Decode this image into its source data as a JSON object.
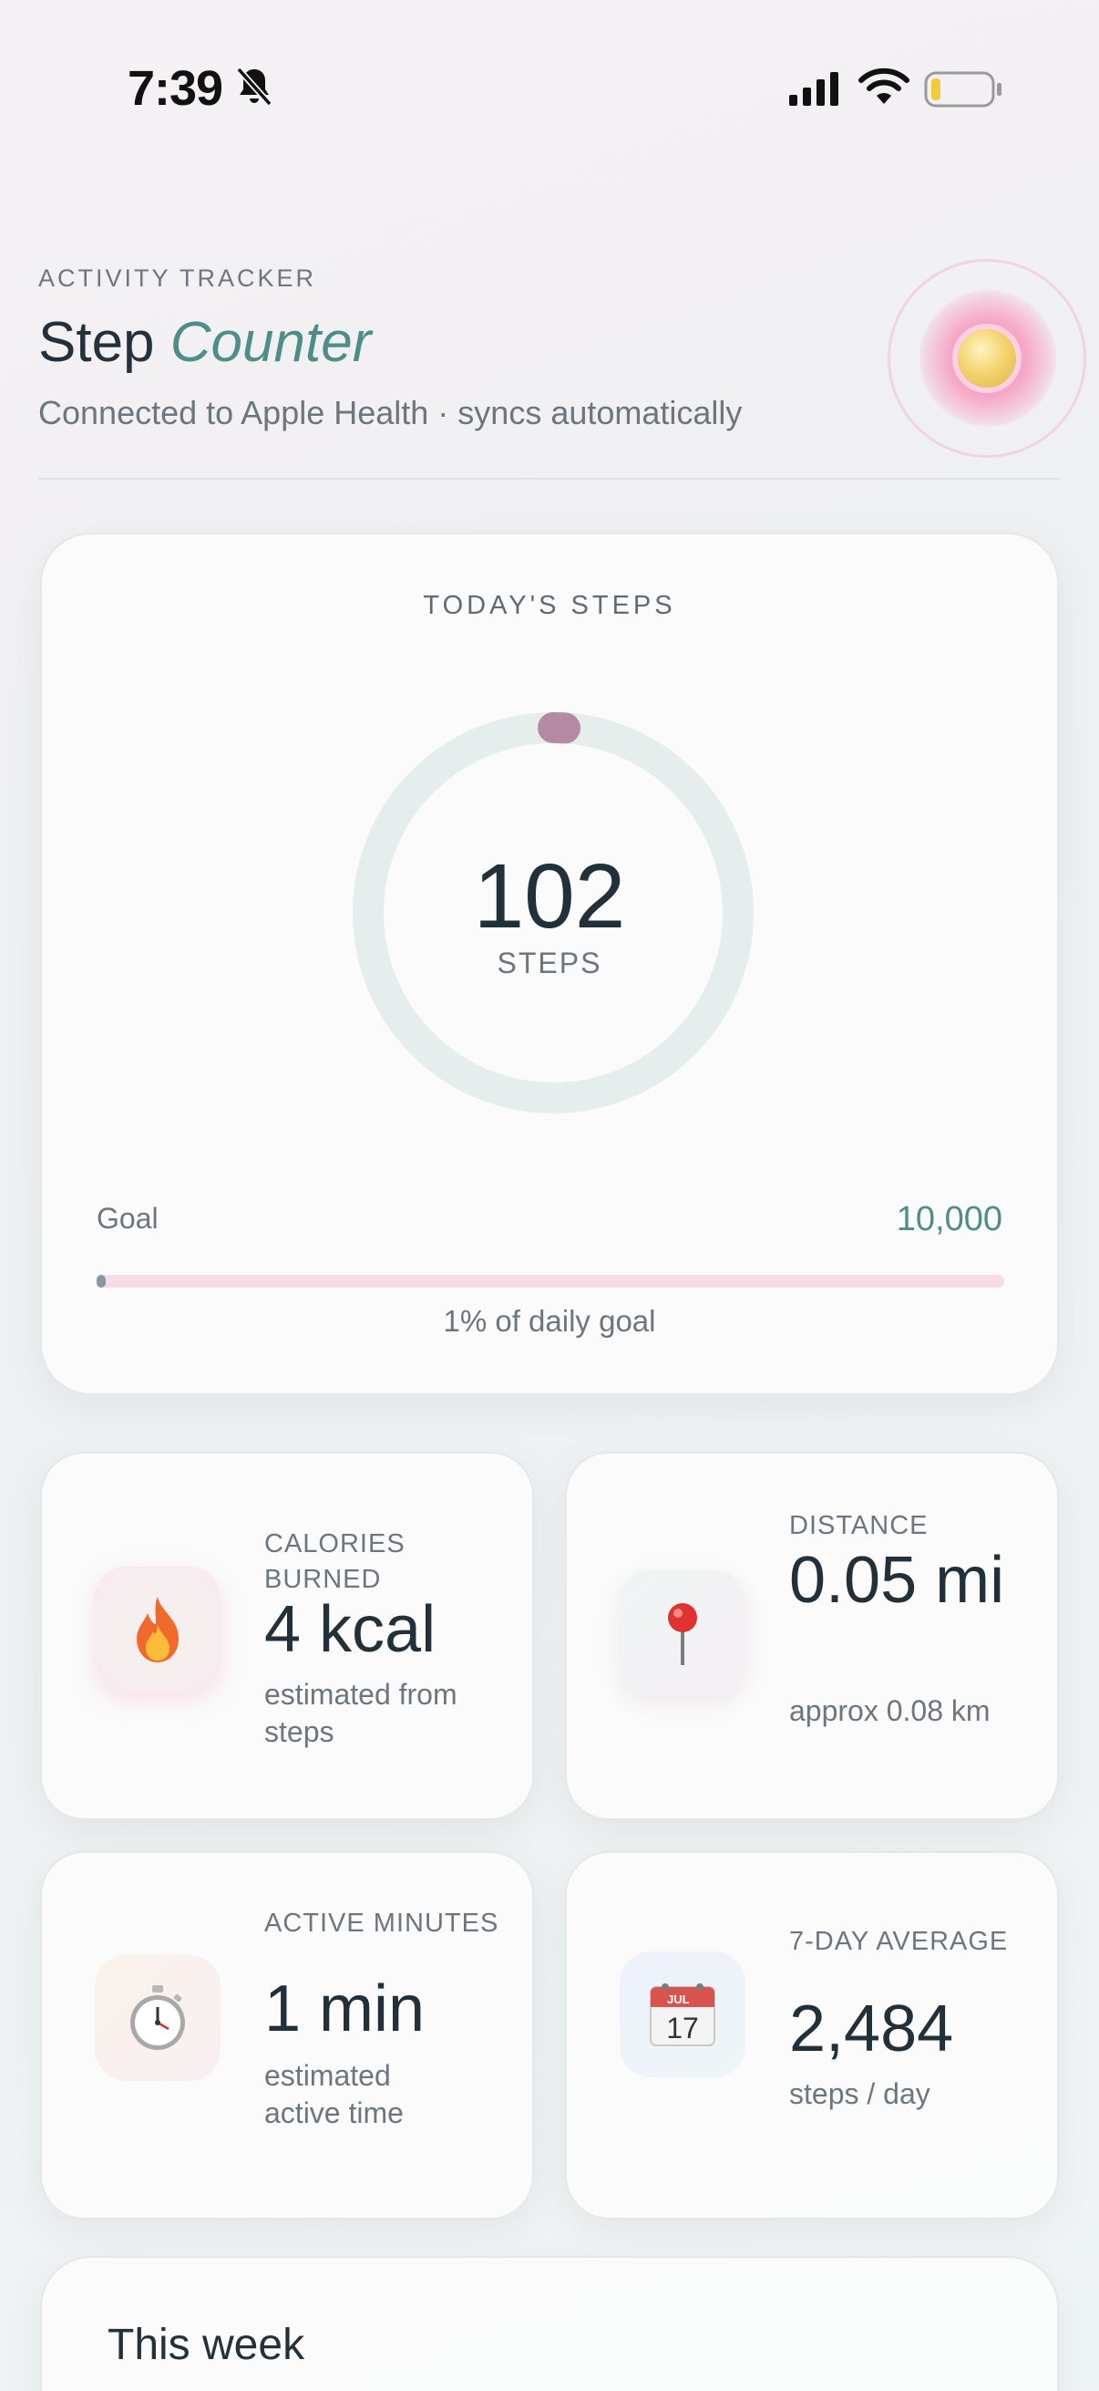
{
  "status_bar": {
    "time": "7:39",
    "icons": [
      "bell-slash-icon",
      "cellular-signal-icon",
      "wifi-icon",
      "battery-low-icon"
    ]
  },
  "header": {
    "eyebrow": "ACTIVITY TRACKER",
    "title_plain": "Step",
    "title_accent": "Counter",
    "subtitle": "Connected to Apple Health · syncs automatically",
    "accent_color": "#4e8e88"
  },
  "today": {
    "title": "TODAY'S STEPS",
    "steps": "102",
    "steps_unit": "STEPS",
    "goal_label": "Goal",
    "goal_value": "10,000",
    "progress_fraction": 0.0102,
    "percent_text": "1% of daily goal",
    "ring_track_color": "#e6eeed",
    "ring_handle_color": "#b78aa3"
  },
  "stats": {
    "calories": {
      "icon": "fire-icon",
      "label": "CALORIES BURNED",
      "value": "4 kcal",
      "note": "estimated from steps"
    },
    "distance": {
      "icon": "pin-icon",
      "label": "DISTANCE",
      "value": "0.05 mi",
      "note": "approx 0.08 km"
    },
    "active": {
      "icon": "stopwatch-icon",
      "label": "ACTIVE MINUTES",
      "value": "1 min",
      "note": "estimated active time"
    },
    "average": {
      "icon": "calendar-icon",
      "label": "7-DAY AVERAGE",
      "value": "2,484",
      "note": "steps / day",
      "calendar_month": "JUL",
      "calendar_day": "17"
    }
  },
  "week": {
    "title": "This week"
  }
}
